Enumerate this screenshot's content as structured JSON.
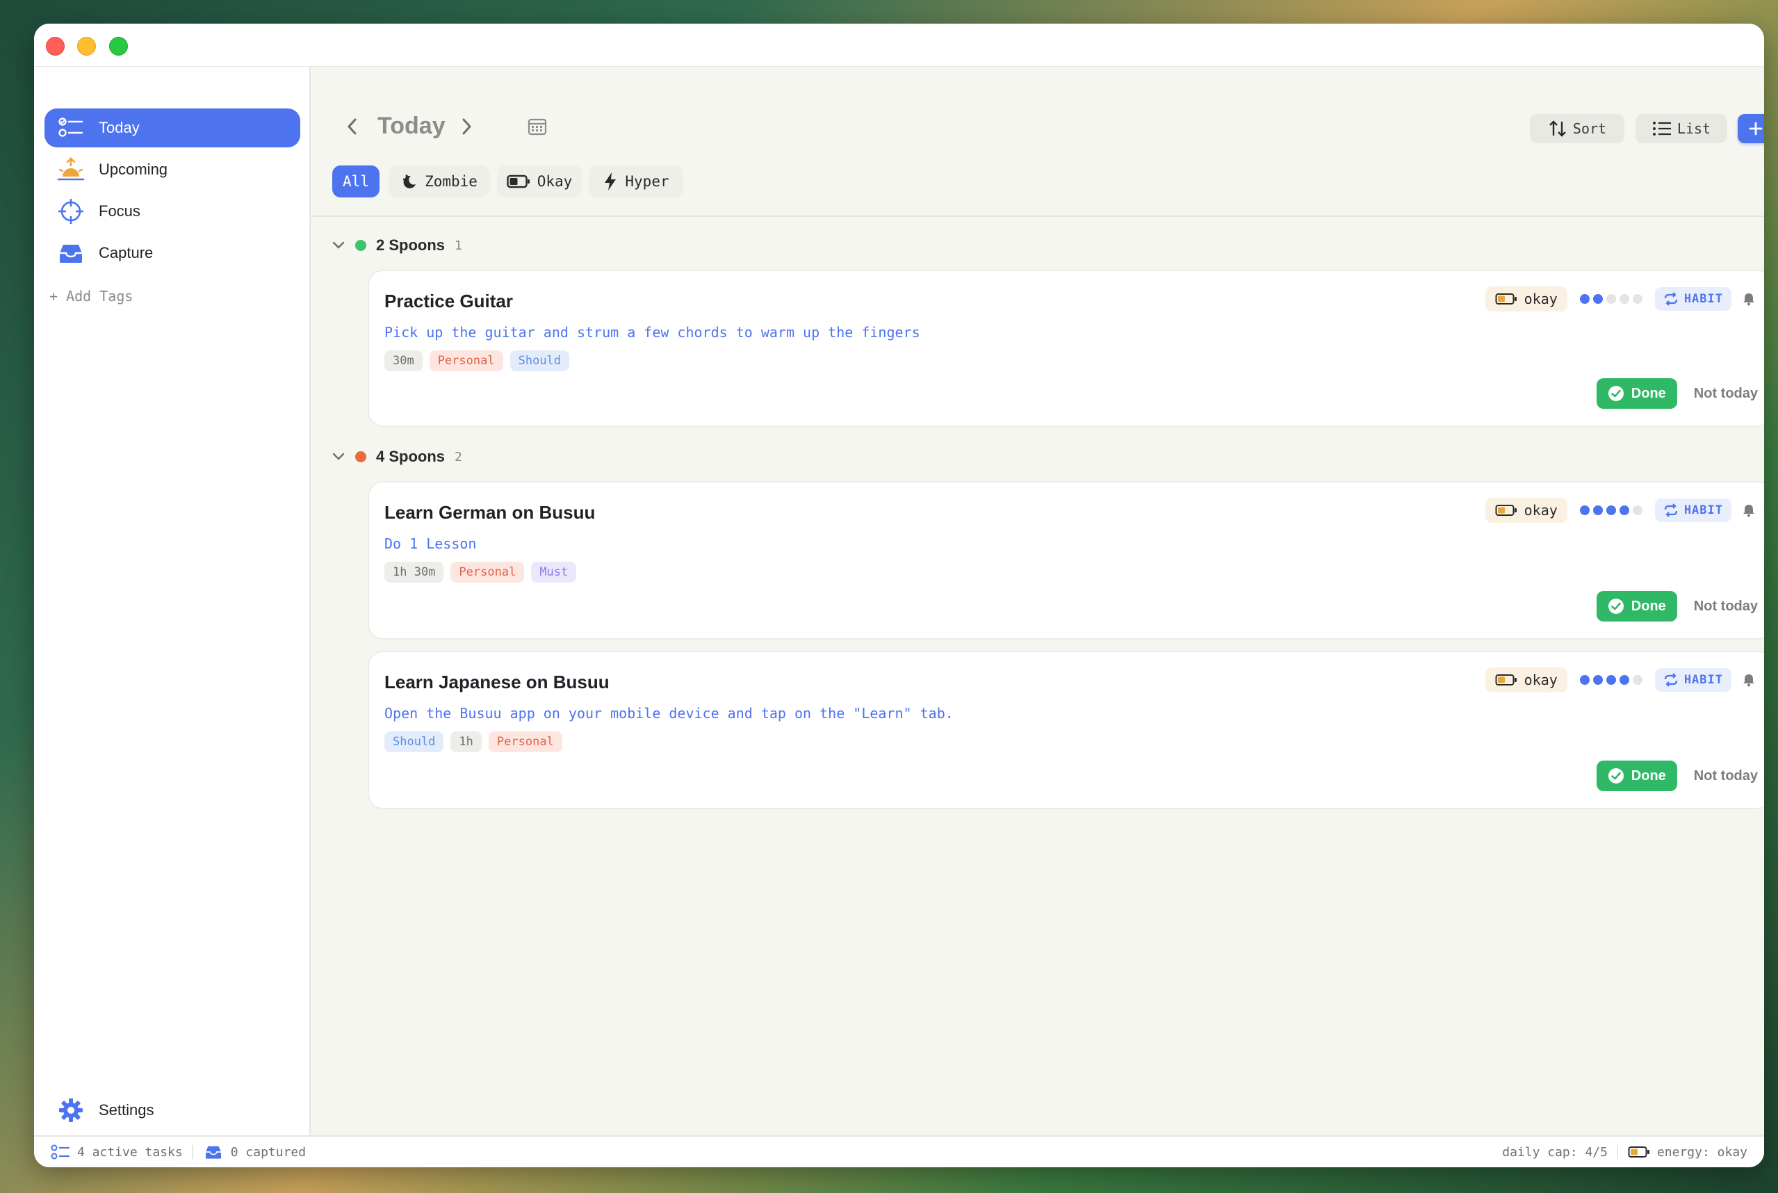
{
  "sidebar": {
    "items": [
      {
        "label": "Today",
        "icon": "today-list-icon",
        "active": true
      },
      {
        "label": "Upcoming",
        "icon": "sunrise-icon",
        "active": false
      },
      {
        "label": "Focus",
        "icon": "crosshair-icon",
        "active": false
      },
      {
        "label": "Capture",
        "icon": "inbox-tray-icon",
        "active": false
      }
    ],
    "add_tags": "+ Add Tags",
    "settings": "Settings"
  },
  "header": {
    "title": "Today",
    "sort_label": "Sort",
    "list_label": "List",
    "filters": [
      "All",
      "Zombie",
      "Okay",
      "Hyper"
    ]
  },
  "sections": [
    {
      "title": "2 Spoons",
      "count": "1",
      "dot_color": "#3cc36b",
      "tasks": [
        {
          "title": "Practice Guitar",
          "description": "Pick up the guitar and strum a few chords to warm up the fingers",
          "tags": [
            "30m",
            "Personal",
            "Should"
          ],
          "energy": "okay",
          "spoons_filled": 2,
          "spoons_total": 5,
          "habit_label": "HABIT",
          "done_label": "Done",
          "not_today_label": "Not today"
        }
      ]
    },
    {
      "title": "4 Spoons",
      "count": "2",
      "dot_color": "#ea6b3d",
      "tasks": [
        {
          "title": "Learn German on Busuu",
          "description": "Do 1 Lesson",
          "tags": [
            "1h 30m",
            "Personal",
            "Must"
          ],
          "energy": "okay",
          "spoons_filled": 4,
          "spoons_total": 5,
          "habit_label": "HABIT",
          "done_label": "Done",
          "not_today_label": "Not today"
        },
        {
          "title": "Learn Japanese on Busuu",
          "description": "Open the Busuu app on your mobile device and tap on the \"Learn\" tab.",
          "tags": [
            "Should",
            "1h",
            "Personal"
          ],
          "energy": "okay",
          "spoons_filled": 4,
          "spoons_total": 5,
          "habit_label": "HABIT",
          "done_label": "Done",
          "not_today_label": "Not today"
        }
      ]
    }
  ],
  "statusbar": {
    "active_tasks": "4 active tasks",
    "captured": "0 captured",
    "daily_cap": "daily cap: 4/5",
    "energy": "energy: okay"
  },
  "colors": {
    "accent": "#4d73ef",
    "done": "#2fb865",
    "window_bg": "#f6f6f1"
  }
}
